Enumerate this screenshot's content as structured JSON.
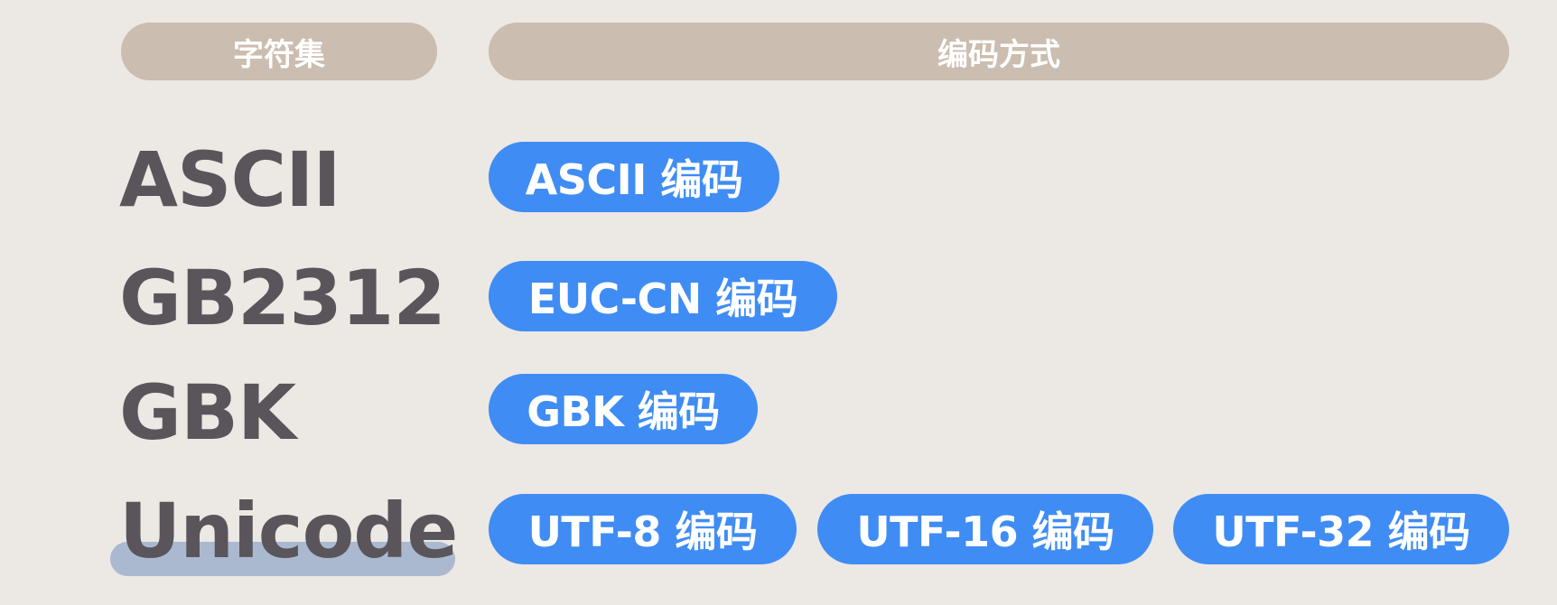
{
  "header": {
    "charset_label": "字符集",
    "encoding_label": "编码方式"
  },
  "rows": {
    "ascii": {
      "charset": "ASCII",
      "encodings": [
        "ASCII 编码"
      ]
    },
    "gb2312": {
      "charset": "GB2312",
      "encodings": [
        "EUC-CN 编码"
      ]
    },
    "gbk": {
      "charset": "GBK",
      "encodings": [
        "GBK 编码"
      ]
    },
    "unicode": {
      "charset": "Unicode",
      "highlighted": true,
      "encodings": [
        "UTF-8 编码",
        "UTF-16 编码",
        "UTF-32 编码"
      ]
    }
  },
  "colors": {
    "background": "#ece8e4",
    "header_pill": "#cbbdaf",
    "encoding_pill": "#3f8cf4",
    "charset_text": "#59555a",
    "highlight": "#aab9cf"
  }
}
